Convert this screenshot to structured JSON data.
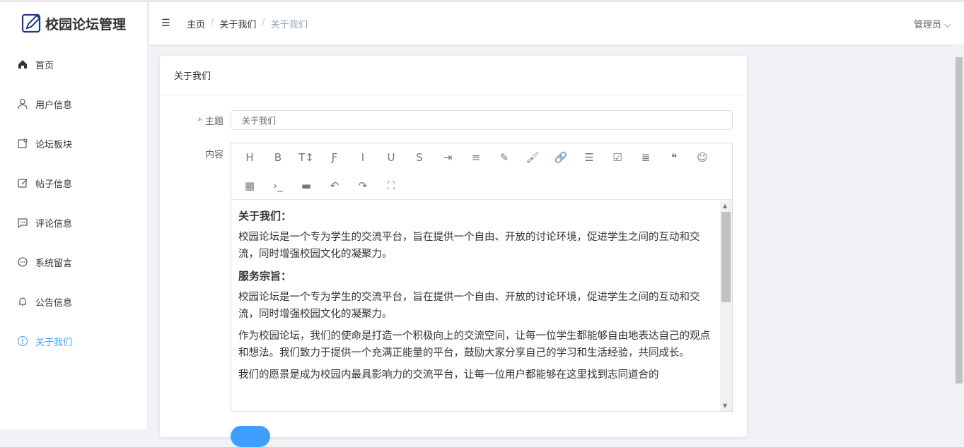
{
  "app": {
    "title": "校园论坛管理"
  },
  "header": {
    "breadcrumb": [
      "主页",
      "关于我们",
      "关于我们"
    ],
    "user": "管理员"
  },
  "sidebar": {
    "items": [
      {
        "label": "首页",
        "icon": "home-icon"
      },
      {
        "label": "用户信息",
        "icon": "user-icon"
      },
      {
        "label": "论坛板块",
        "icon": "board-icon"
      },
      {
        "label": "帖子信息",
        "icon": "edit-icon"
      },
      {
        "label": "评论信息",
        "icon": "comment-icon"
      },
      {
        "label": "系统留言",
        "icon": "message-icon"
      },
      {
        "label": "公告信息",
        "icon": "bell-icon"
      },
      {
        "label": "关于我们",
        "icon": "info-icon",
        "active": true
      }
    ]
  },
  "card": {
    "title": "关于我们",
    "subject_label": "主题",
    "subject_value": "关于我们",
    "content_label": "内容"
  },
  "editor": {
    "toolbar": [
      "H",
      "B",
      "T↕",
      "Ƒ",
      "I",
      "U",
      "S",
      "⇥",
      "≡",
      "✎",
      "🖌",
      "🔗",
      "☰",
      "☑",
      "≣",
      "❝",
      "☺",
      "▦",
      "›_",
      "▬",
      "↶",
      "↷",
      "⛶"
    ],
    "content": {
      "h1": "关于我们：",
      "p1": "校园论坛是一个专为学生的交流平台，旨在提供一个自由、开放的讨论环境，促进学生之间的互动和交流，同时增强校园文化的凝聚力。",
      "h2": "服务宗旨：",
      "p2": "校园论坛是一个专为学生的交流平台，旨在提供一个自由、开放的讨论环境，促进学生之间的互动和交流，同时增强校园文化的凝聚力。",
      "p3": "作为校园论坛，我们的使命是打造一个积极向上的交流空间，让每一位学生都能够自由地表达自己的观点和想法。我们致力于提供一个充满正能量的平台，鼓励大家分享自己的学习和生活经验，共同成长。",
      "p4": "我们的愿景是成为校园内最具影响力的交流平台，让每一位用户都能够在这里找到志同道合的"
    }
  }
}
